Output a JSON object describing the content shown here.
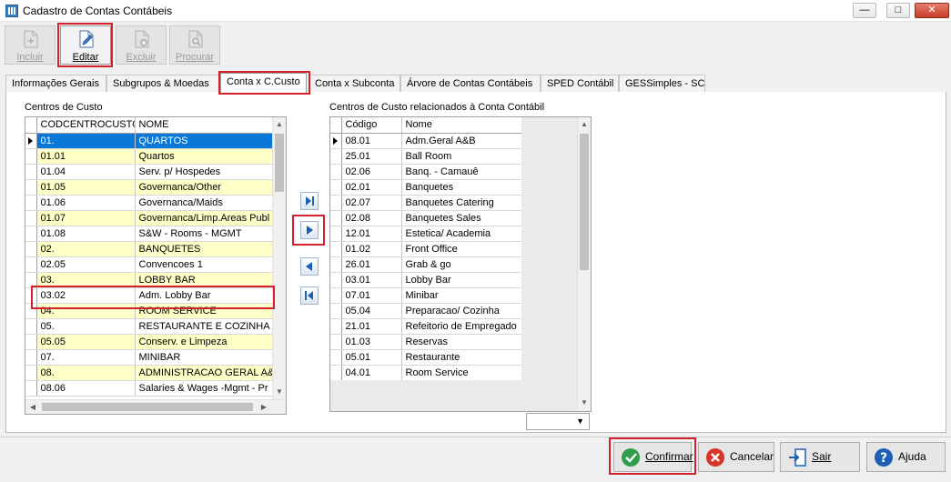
{
  "window": {
    "title": "Cadastro de Contas Contábeis",
    "minimize_glyph": "—",
    "maximize_glyph": "□",
    "close_glyph": "✕"
  },
  "toolbar": {
    "buttons": [
      {
        "label": "Incluir",
        "icon": "add-document-icon",
        "enabled": false
      },
      {
        "label": "Editar",
        "icon": "edit-document-icon",
        "enabled": true
      },
      {
        "label": "Excluir",
        "icon": "delete-document-icon",
        "enabled": false
      },
      {
        "label": "Procurar",
        "icon": "search-document-icon",
        "enabled": false
      }
    ]
  },
  "tabs": [
    {
      "label": "Informações Gerais"
    },
    {
      "label": "Subgrupos & Moedas"
    },
    {
      "label": "Conta x C.Custo",
      "active": true
    },
    {
      "label": "Conta x Subconta"
    },
    {
      "label": "Árvore de Contas Contábeis"
    },
    {
      "label": "SPED Contábil"
    },
    {
      "label": "GESSimples - SC"
    }
  ],
  "left": {
    "label": "Centros de Custo",
    "columns": [
      "CODCENTROCUSTO",
      "NOME"
    ],
    "rows": [
      {
        "code": "01.",
        "name": "QUARTOS"
      },
      {
        "code": "01.01",
        "name": "Quartos"
      },
      {
        "code": "01.04",
        "name": "Serv. p/ Hospedes"
      },
      {
        "code": "01.05",
        "name": "Governanca/Other"
      },
      {
        "code": "01.06",
        "name": "Governanca/Maids"
      },
      {
        "code": "01.07",
        "name": "Governanca/Limp.Areas Publ"
      },
      {
        "code": "01.08",
        "name": "S&W - Rooms - MGMT"
      },
      {
        "code": "02.",
        "name": "BANQUETES"
      },
      {
        "code": "02.05",
        "name": "Convencoes 1"
      },
      {
        "code": "03.",
        "name": "LOBBY BAR"
      },
      {
        "code": "03.02",
        "name": "Adm. Lobby Bar"
      },
      {
        "code": "04.",
        "name": "ROOM SERVICE"
      },
      {
        "code": "05.",
        "name": "RESTAURANTE E COZINHA"
      },
      {
        "code": "05.05",
        "name": "Conserv. e Limpeza"
      },
      {
        "code": "07.",
        "name": "MINIBAR"
      },
      {
        "code": "08.",
        "name": "ADMINISTRACAO GERAL A&E"
      },
      {
        "code": "08.06",
        "name": "Salaries & Wages -Mgmt - Pr"
      }
    ]
  },
  "move_buttons": [
    {
      "icon": "move-all-right-icon"
    },
    {
      "icon": "move-right-icon"
    },
    {
      "icon": "move-left-icon"
    },
    {
      "icon": "move-all-left-icon"
    }
  ],
  "right": {
    "label": "Centros de Custo relacionados à Conta Contábil",
    "columns": [
      "Código",
      "Nome"
    ],
    "rows": [
      {
        "code": "08.01",
        "name": "Adm.Geral A&B"
      },
      {
        "code": "25.01",
        "name": "Ball Room"
      },
      {
        "code": "02.06",
        "name": "Banq. - Camauê"
      },
      {
        "code": "02.01",
        "name": "Banquetes"
      },
      {
        "code": "02.07",
        "name": "Banquetes Catering"
      },
      {
        "code": "02.08",
        "name": "Banquetes Sales"
      },
      {
        "code": "12.01",
        "name": "Estetica/ Academia"
      },
      {
        "code": "01.02",
        "name": "Front Office"
      },
      {
        "code": "26.01",
        "name": "Grab & go"
      },
      {
        "code": "03.01",
        "name": "Lobby Bar"
      },
      {
        "code": "07.01",
        "name": "Minibar"
      },
      {
        "code": "05.04",
        "name": "Preparacao/ Cozinha"
      },
      {
        "code": "21.01",
        "name": "Refeitorio de Empregado"
      },
      {
        "code": "01.03",
        "name": "Reservas"
      },
      {
        "code": "05.01",
        "name": "Restaurante"
      },
      {
        "code": "04.01",
        "name": "Room Service"
      }
    ],
    "combo_value": ""
  },
  "bottom": {
    "confirmar": "Confirmar",
    "cancelar": "Cancelar",
    "sair": "Sair",
    "ajuda": "Ajuda"
  }
}
